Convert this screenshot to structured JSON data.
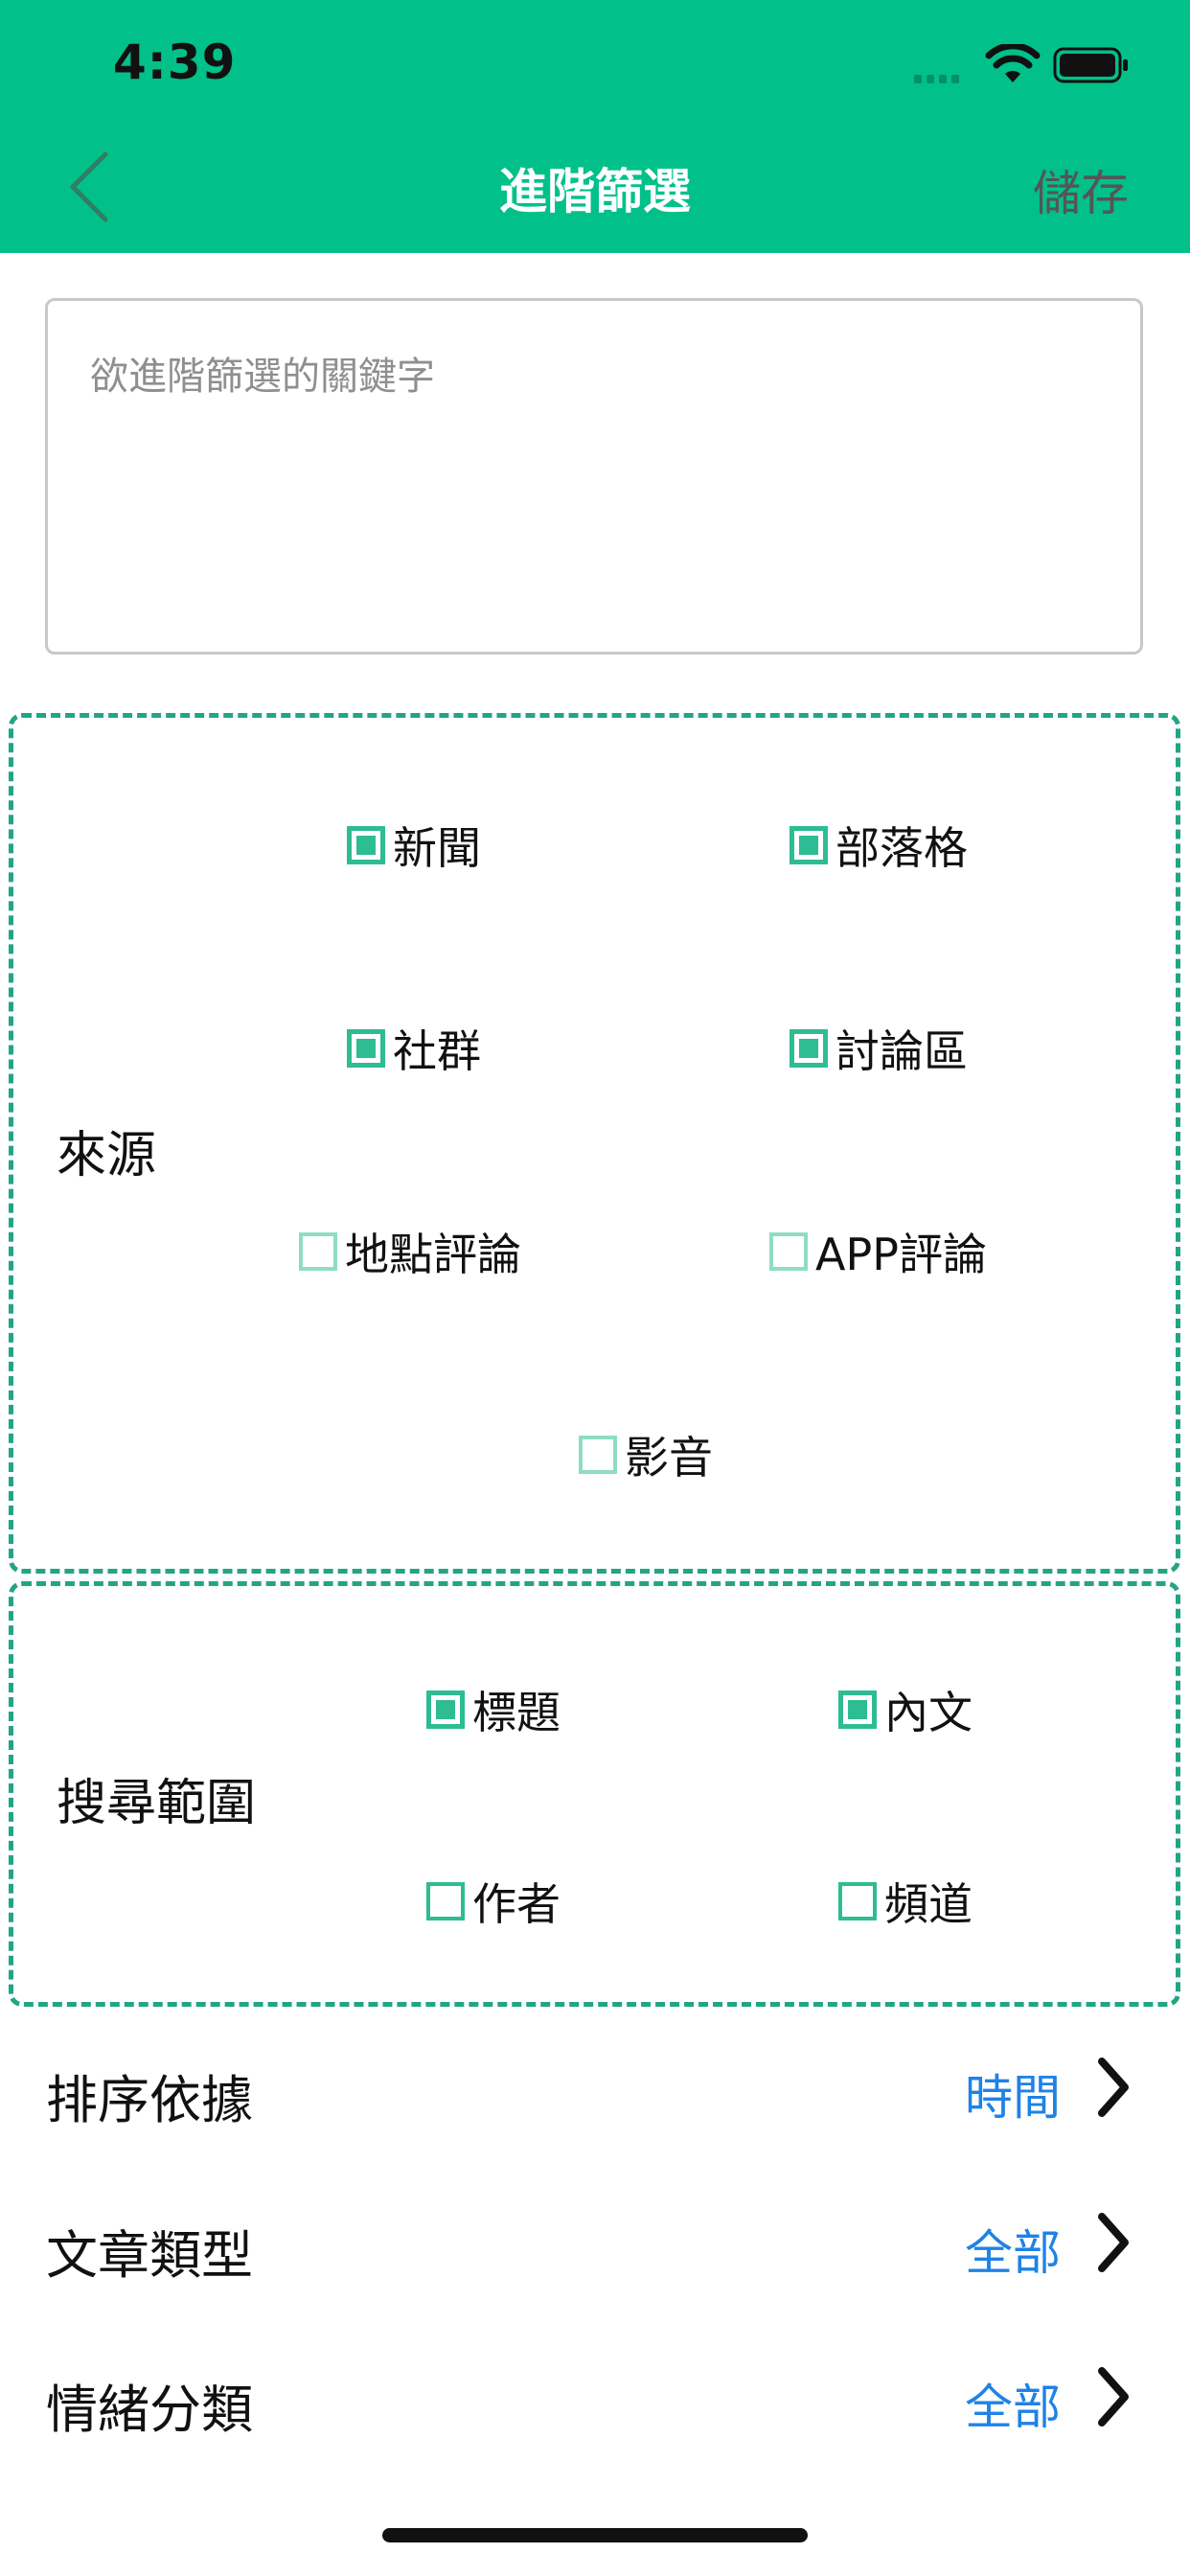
{
  "status_bar": {
    "time": "4:39"
  },
  "nav": {
    "title": "進階篩選",
    "save_label": "儲存",
    "back_icon": "chevron-left-icon"
  },
  "keyword": {
    "placeholder": "欲進階篩選的關鍵字",
    "value": ""
  },
  "source": {
    "label": "來源",
    "options": [
      {
        "label": "新聞",
        "checked": true
      },
      {
        "label": "部落格",
        "checked": true
      },
      {
        "label": "社群",
        "checked": true
      },
      {
        "label": "討論區",
        "checked": true
      },
      {
        "label": "地點評論",
        "checked": false
      },
      {
        "label": "APP評論",
        "checked": false
      },
      {
        "label": "影音",
        "checked": false
      }
    ]
  },
  "scope": {
    "label": "搜尋範圍",
    "options": [
      {
        "label": "標題",
        "checked": true
      },
      {
        "label": "內文",
        "checked": true
      },
      {
        "label": "作者",
        "checked": false
      },
      {
        "label": "頻道",
        "checked": false
      }
    ]
  },
  "settings": [
    {
      "label": "排序依據",
      "value": "時間"
    },
    {
      "label": "文章類型",
      "value": "全部"
    },
    {
      "label": "情緒分類",
      "value": "全部"
    }
  ],
  "colors": {
    "header": "#02c08a",
    "checkbox": "#2ebc93",
    "checkbox_unchecked": "#8fdcc6",
    "section_border": "#22a585",
    "link": "#1f82e6"
  }
}
